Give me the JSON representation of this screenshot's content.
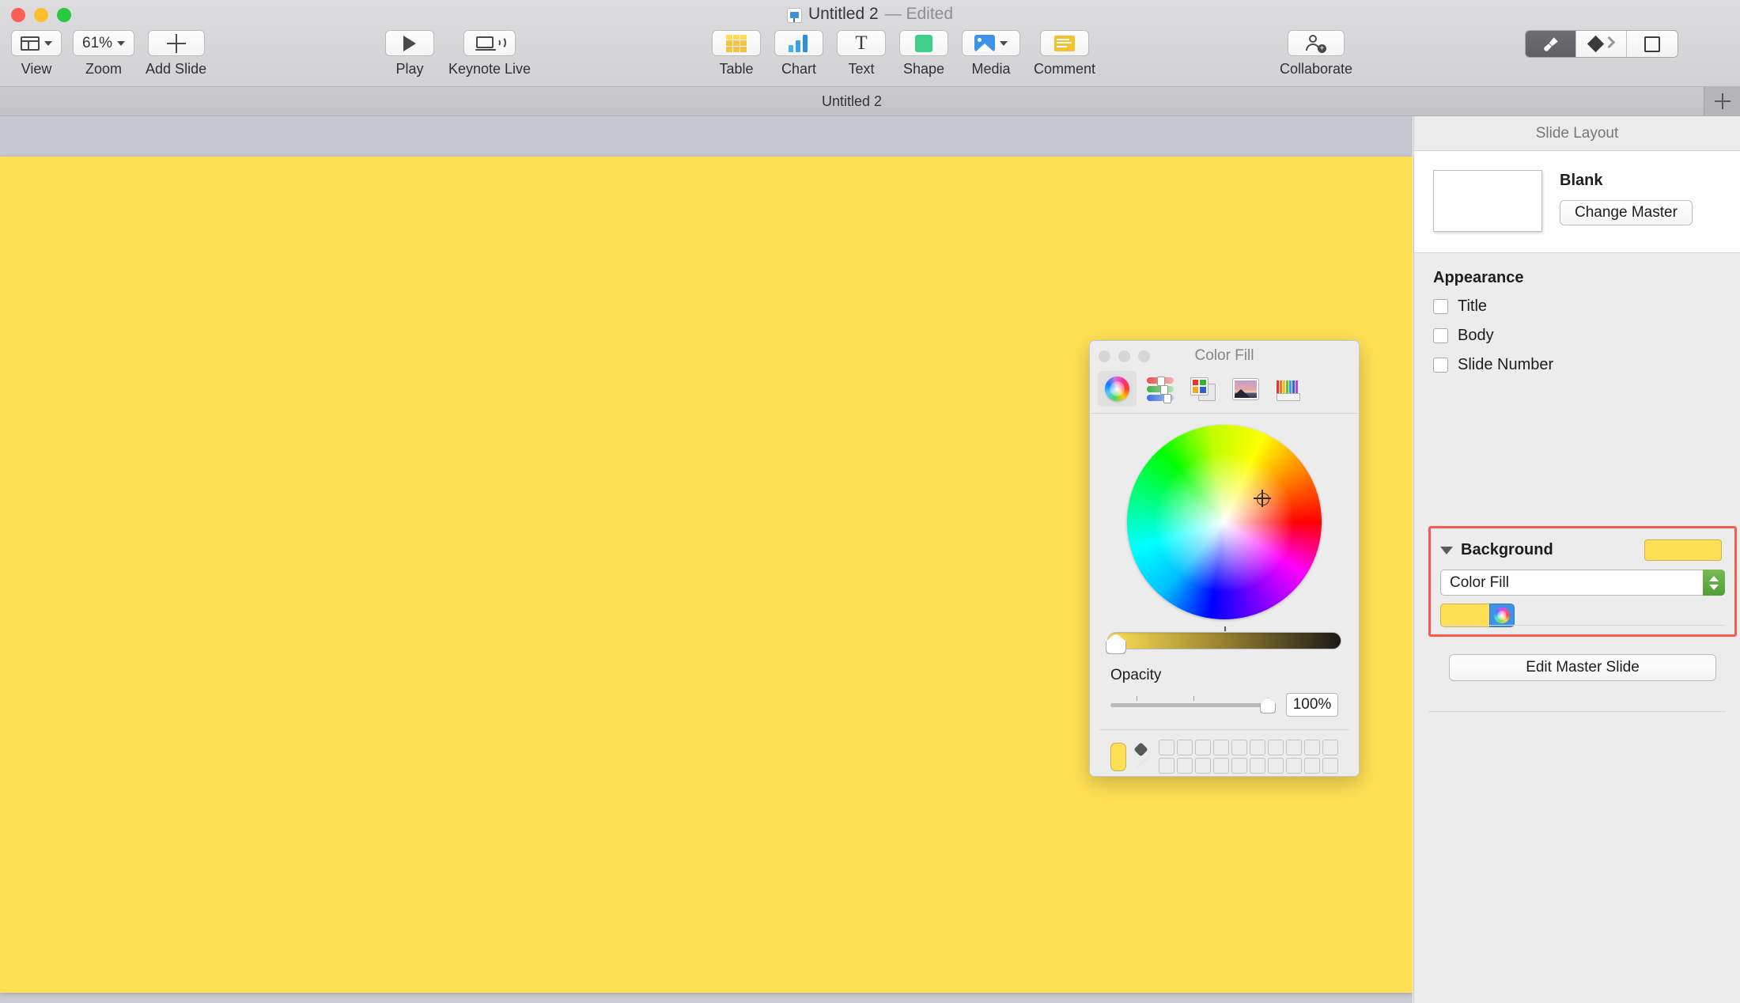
{
  "window": {
    "title": "Untitled 2",
    "status": "— Edited",
    "doc_icon": "keynote-document-icon"
  },
  "toolbar": {
    "left": [
      {
        "label": "View",
        "icon": "view-layout-icon",
        "has_chevron": true
      },
      {
        "label": "Zoom",
        "value": "61%",
        "icon": "zoom-value",
        "has_chevron": true
      },
      {
        "label": "Add Slide",
        "icon": "plus-icon",
        "has_chevron": false
      }
    ],
    "play_group": [
      {
        "label": "Play",
        "icon": "play-icon"
      },
      {
        "label": "Keynote Live",
        "icon": "keynote-live-icon"
      }
    ],
    "insert_group": [
      {
        "label": "Table",
        "icon": "table-icon",
        "has_chevron": false
      },
      {
        "label": "Chart",
        "icon": "chart-icon",
        "has_chevron": false
      },
      {
        "label": "Text",
        "icon": "text-icon",
        "has_chevron": false
      },
      {
        "label": "Shape",
        "icon": "shape-icon",
        "has_chevron": false
      },
      {
        "label": "Media",
        "icon": "media-icon",
        "has_chevron": true
      },
      {
        "label": "Comment",
        "icon": "comment-icon",
        "has_chevron": false
      }
    ],
    "collaborate": {
      "label": "Collaborate",
      "icon": "add-person-icon"
    },
    "inspector_tabs": [
      {
        "label": "Format",
        "icon": "paint-brush-icon",
        "active": true
      },
      {
        "label": "Animate",
        "icon": "animate-diamond-icon",
        "active": false
      },
      {
        "label": "Document",
        "icon": "document-square-icon",
        "active": false
      }
    ]
  },
  "tabbar": {
    "title": "Untitled 2",
    "add_tab_icon": "plus-icon"
  },
  "canvas": {
    "slide_background_color": "#ffe055"
  },
  "inspector": {
    "header": "Slide Layout",
    "master": {
      "name": "Blank",
      "change_button": "Change Master"
    },
    "appearance": {
      "title": "Appearance",
      "options": [
        {
          "label": "Title",
          "checked": false
        },
        {
          "label": "Body",
          "checked": false
        },
        {
          "label": "Slide Number",
          "checked": false
        }
      ]
    },
    "background": {
      "title": "Background",
      "disclosure_icon": "triangle-down-icon",
      "swatch_color": "#ffe055",
      "fill_type": "Color Fill",
      "fill_color": "#ffe055",
      "color_wheel_button_icon": "color-wheel-icon",
      "highlight_color": "#fa5a52"
    },
    "edit_master_button": "Edit Master Slide"
  },
  "color_panel": {
    "title": "Color Fill",
    "tabs": [
      {
        "name": "color-wheel-tab",
        "icon": "color-wheel-icon",
        "active": true
      },
      {
        "name": "color-sliders-tab",
        "icon": "rgb-sliders-icon",
        "active": false
      },
      {
        "name": "color-palettes-tab",
        "icon": "color-palettes-icon",
        "active": false
      },
      {
        "name": "image-palettes-tab",
        "icon": "image-palette-icon",
        "active": false
      },
      {
        "name": "pencils-tab",
        "icon": "pencils-icon",
        "active": false
      }
    ],
    "selected_color": "#ffe055",
    "brightness": {
      "value": 100,
      "thumb_position_pct": 0
    },
    "opacity": {
      "label": "Opacity",
      "value": "100%",
      "thumb_position_pct": 100
    },
    "swatch_rows": 2,
    "swatch_cols": 10,
    "eyedropper_icon": "eyedropper-icon"
  }
}
